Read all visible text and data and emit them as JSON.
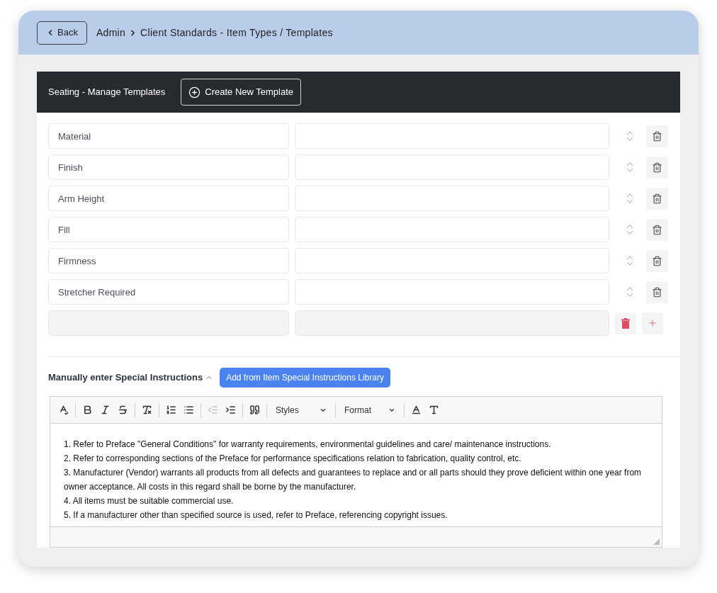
{
  "header": {
    "back_label": "Back",
    "breadcrumb": [
      "Admin",
      "Client Standards - Item Types / Templates"
    ]
  },
  "panel": {
    "title": "Seating - Manage Templates",
    "create_label": "Create New Template"
  },
  "rows": [
    {
      "kind": "field",
      "name": "Material"
    },
    {
      "kind": "field",
      "name": "Finish"
    },
    {
      "kind": "field",
      "name": "Arm Height"
    },
    {
      "kind": "field",
      "name": "Fill"
    },
    {
      "kind": "field",
      "name": "Firmness"
    },
    {
      "kind": "field",
      "name": "Stretcher Required"
    },
    {
      "kind": "new"
    }
  ],
  "special": {
    "title": "Manually enter Special Instructions",
    "expanded": true,
    "library_label": "Add from Item Special Instructions Library"
  },
  "toolbar": [
    {
      "kind": "spellcheck",
      "disabled": false
    },
    {
      "kind": "separator"
    },
    {
      "kind": "bold",
      "disabled": false
    },
    {
      "kind": "italic",
      "disabled": false
    },
    {
      "kind": "strike",
      "disabled": false
    },
    {
      "kind": "separator"
    },
    {
      "kind": "clear",
      "disabled": false
    },
    {
      "kind": "separator"
    },
    {
      "kind": "ordered",
      "disabled": false
    },
    {
      "kind": "bullets",
      "disabled": false
    },
    {
      "kind": "separator"
    },
    {
      "kind": "outdent",
      "disabled": true
    },
    {
      "kind": "indent",
      "disabled": false
    },
    {
      "kind": "separator"
    },
    {
      "kind": "quote",
      "disabled": false
    },
    {
      "kind": "separator"
    },
    {
      "kind": "dropdown",
      "label": "Styles"
    },
    {
      "kind": "separator"
    },
    {
      "kind": "dropdown",
      "label": "Format"
    },
    {
      "kind": "separator"
    },
    {
      "kind": "textcolor",
      "disabled": false
    },
    {
      "kind": "bgcolor",
      "disabled": false
    }
  ],
  "instructions": [
    "1. Refer to Preface \"General Conditions\" for warranty requirements, environmental guidelines and care/ maintenance instructions.",
    "2. Refer to corresponding sections of the Preface for performance specifications relation to fabrication, quality control, etc.",
    "3. Manufacturer (Vendor) warrants all products from all defects and guarantees to replace and or all parts should they prove deficient within one year from owner acceptance. All costs in this regard shall be borne by the manufacturer.",
    "4. All items must be suitable commercial use.",
    "5. If a manufacturer other than specified source is used, refer to Preface, referencing copyright issues."
  ]
}
